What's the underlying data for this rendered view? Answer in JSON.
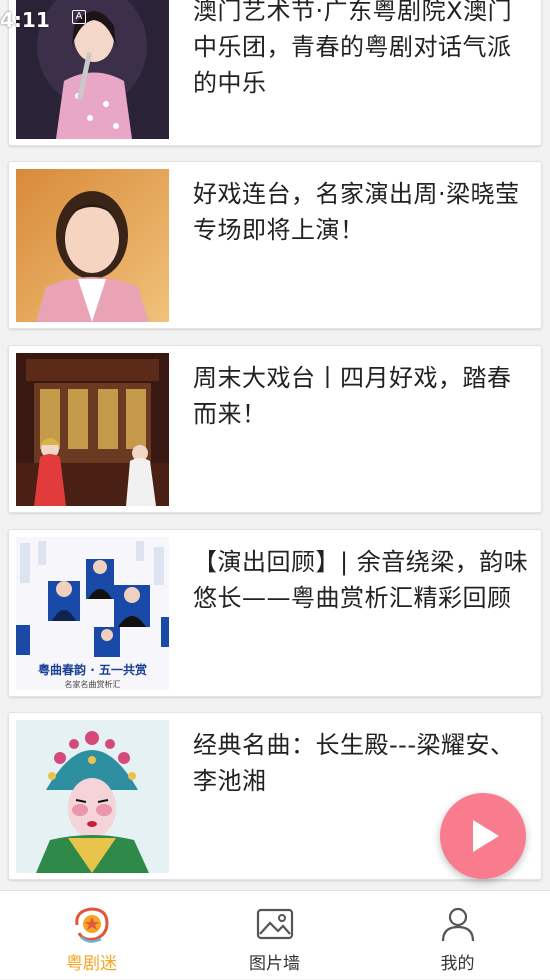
{
  "status_bar": {
    "time": "4:11",
    "indicator": "A"
  },
  "articles": [
    {
      "title": "澳门艺术节·广东粤剧院X澳门中乐团，青春的粤剧对话气派的中乐",
      "thumb": "performer-singing-pink-dress"
    },
    {
      "title": "好戏连台，名家演出周·梁晓莹专场即将上演！",
      "thumb": "portrait-pink-blazer"
    },
    {
      "title": "周末大戏台丨四月好戏，踏春而来！",
      "thumb": "opera-stage-scene"
    },
    {
      "title": "【演出回顾】| 余音绕梁，韵味悠长——粤曲赏析汇精彩回顾",
      "thumb": "concert-poster",
      "thumb_caption": "粤曲春韵 · 五一共赏",
      "thumb_subcaption": "名家名曲赏析汇"
    },
    {
      "title": "经典名曲：长生殿---梁耀安、李池湘",
      "thumb": "opera-headdress-portrait"
    }
  ],
  "fab": {
    "icon": "play-icon",
    "color": "#f97b8e"
  },
  "bottom_nav": [
    {
      "label": "粤剧迷",
      "icon": "opera-fan-icon",
      "active": true
    },
    {
      "label": "图片墙",
      "icon": "image-icon",
      "active": false
    },
    {
      "label": "我的",
      "icon": "person-icon",
      "active": false
    }
  ],
  "colors": {
    "active_tab": "#f5a623",
    "inactive_tab": "#333333",
    "background": "#f2f2f2"
  }
}
